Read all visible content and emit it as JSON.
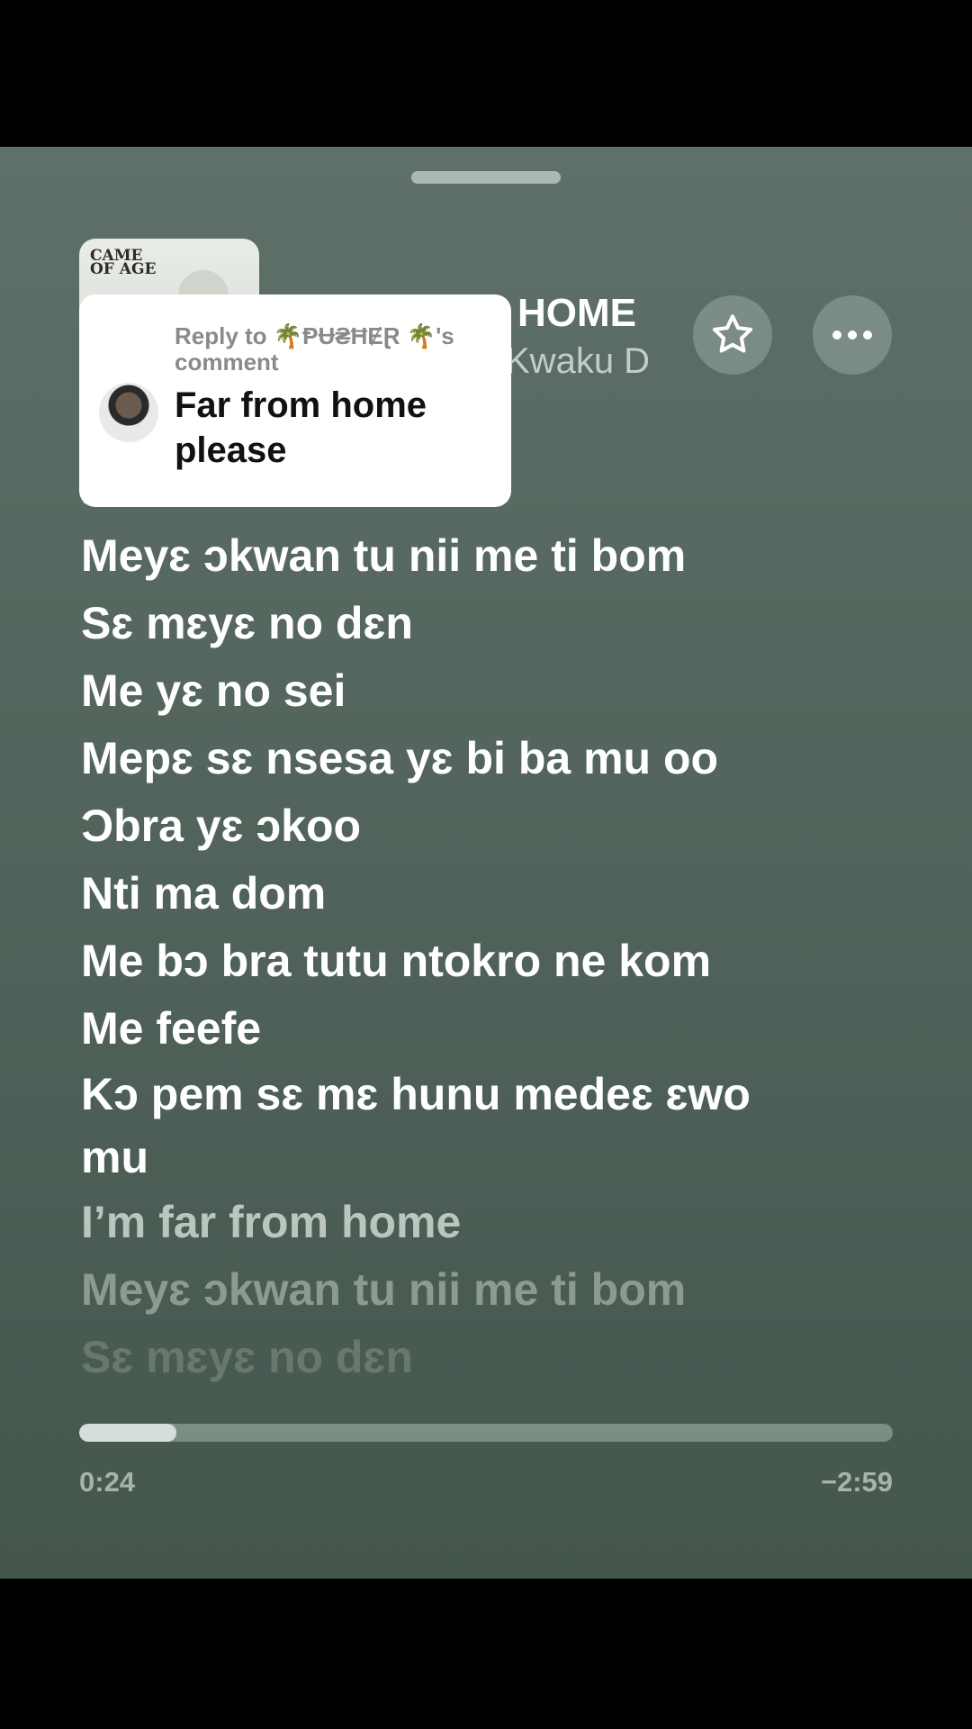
{
  "now_playing": {
    "title": "HOME",
    "artist": "Kwaku D",
    "album_art_text": "CAME OF AGE",
    "elapsed": "0:24",
    "remaining": "−2:59",
    "progress_fraction": 0.12
  },
  "icons": {
    "favorite": "star-icon",
    "more": "ellipsis-icon",
    "grabber": "sheet-handle"
  },
  "reply_overlay": {
    "header": "Reply to 🌴ⱣɄ₴ĦɆⱤ 🌴's comment",
    "comment": "Far from home please"
  },
  "lyrics": [
    "I’m far from home",
    "Meyɛ  ɔkwan tu nii me ti bom",
    "Sɛ mɛyɛ no dɛn",
    "Me yɛ no sei",
    "Mepɛ sɛ nsesa yɛ bi ba mu oo",
    "Ɔbra yɛ ɔkoo",
    "Nti ma dom",
    "Me bɔ bra  tutu  ntokro  ne kom",
    "Me feefe",
    "Kɔ pem sɛ mɛ hunu medeɛ ɛwo mu",
    "I’m far from home",
    "Meyɛ  ɔkwan tu nii me ti bom",
    "Sɛ mɛyɛ no dɛn"
  ],
  "colors": {
    "background_top": "#5f7069",
    "background_bottom": "#45564d",
    "card": "#ffffff"
  }
}
